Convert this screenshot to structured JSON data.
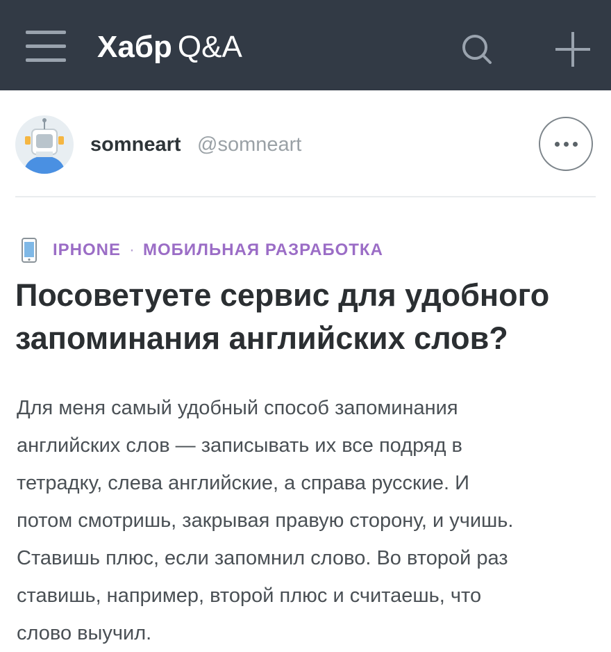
{
  "header": {
    "brand": "Хабр",
    "product": "Q&A",
    "menu_icon": "hamburger-menu-icon",
    "search_icon": "search-icon",
    "plus_icon": "plus-icon",
    "background_color": "#323a45"
  },
  "author": {
    "name": "somneart",
    "handle": "@somneart",
    "avatar_icon": "robot-avatar",
    "more_icon": "more-dots-icon"
  },
  "question": {
    "tag_icon": "phone-icon",
    "tags": [
      "IPHONE",
      "МОБИЛЬНАЯ РАЗРАБОТКА"
    ],
    "tag_separator": "·",
    "tag_color": "#9b6dc6",
    "title": "Посоветуете сервис для удобного\nзапоминания английских слов?",
    "body": "Для меня самый удобный способ запоминания\nанглийских слов — записывать их все подряд в\nтетрадку, слева английские, а справа русские. И\nпотом смотришь, закрывая правую сторону, и учишь.\nСтавишь плюс, если запомнил слово. Во второй раз\nставишь, например, второй плюс и считаешь, что\nслово выучил."
  }
}
